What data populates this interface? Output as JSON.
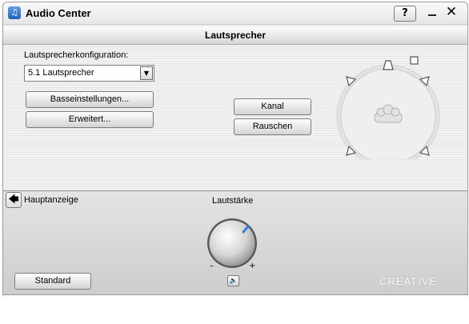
{
  "window": {
    "title": "Audio Center",
    "help_label": "?",
    "minimize_label": "_",
    "close_label": "✕"
  },
  "section": {
    "title": "Lautsprecher"
  },
  "config": {
    "label": "Lautsprecherkonfiguration:",
    "selected": "5.1 Lautsprecher",
    "buttons": {
      "basic": "Basseinstellungen...",
      "advanced": "Erweitert..."
    }
  },
  "test": {
    "channel": "Kanal",
    "noise": "Rauschen"
  },
  "nav": {
    "back_label": "Hauptanzeige"
  },
  "volume": {
    "label": "Lautstärke",
    "minus": "–",
    "plus": "+"
  },
  "footer": {
    "standard_label": "Standard",
    "brand": "CREATIVE"
  },
  "icons": {
    "app": "music-note-icon",
    "back": "arrow-left-icon",
    "mute": "speaker-icon",
    "dropdown": "chevron-down-icon",
    "listener": "listener-icon"
  },
  "colors": {
    "knob_indicator": "#2f7fe0",
    "app_icon": "#2a6fc9"
  }
}
